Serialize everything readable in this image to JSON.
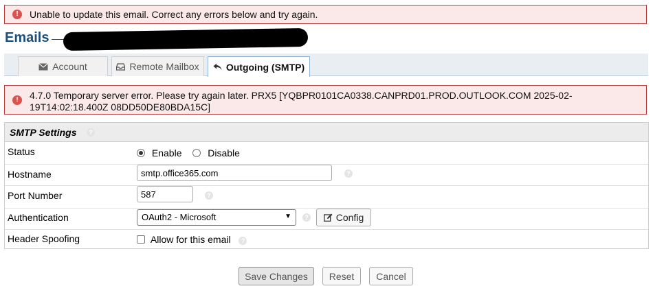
{
  "alerts": {
    "top_error": "Unable to update this email. Correct any errors below and try again.",
    "smtp_error": "4.7.0 Temporary server error. Please try again later. PRX5 [YQBPR0101CA0338.CANPRD01.PROD.OUTLOOK.COM 2025-02-19T14:02:18.400Z 08DD50DE80BDA15C]"
  },
  "page": {
    "title": "Emails"
  },
  "tabs": [
    {
      "label": "Account",
      "icon": "envelope-icon"
    },
    {
      "label": "Remote Mailbox",
      "icon": "inbox-icon"
    },
    {
      "label": "Outgoing (SMTP)",
      "icon": "reply-icon",
      "active": true
    }
  ],
  "smtp": {
    "section_title": "SMTP Settings",
    "status": {
      "label": "Status",
      "enable": "Enable",
      "disable": "Disable",
      "selected": "Enable"
    },
    "hostname": {
      "label": "Hostname",
      "value": "smtp.office365.com"
    },
    "port": {
      "label": "Port Number",
      "value": "587"
    },
    "auth": {
      "label": "Authentication",
      "selected": "OAuth2 - Microsoft",
      "config_label": "Config"
    },
    "spoofing": {
      "label": "Header Spoofing",
      "option": "Allow for this email",
      "checked": false
    }
  },
  "actions": {
    "save": "Save Changes",
    "reset": "Reset",
    "cancel": "Cancel"
  },
  "colors": {
    "error_bg": "#fbe9e9",
    "error_border": "#b83c3c",
    "title": "#1f4e79",
    "error_icon": "#d9534f"
  }
}
